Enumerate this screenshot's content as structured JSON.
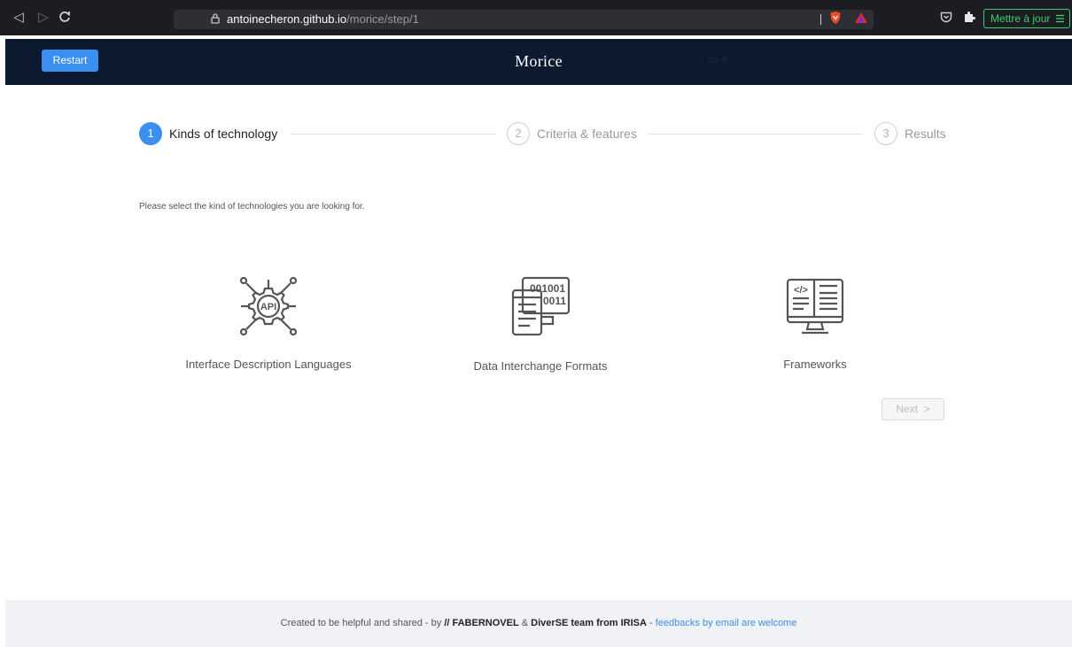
{
  "browser": {
    "url_domain": "antoinecheron.github.io",
    "url_path": "/morice/step/1",
    "update_label": "Mettre à jour"
  },
  "header": {
    "restart_label": "Restart",
    "title": "Morice",
    "col_label": "col-8"
  },
  "steps": [
    {
      "number": "1",
      "label": "Kinds of technology",
      "active": true
    },
    {
      "number": "2",
      "label": "Criteria & features",
      "active": false
    },
    {
      "number": "3",
      "label": "Results",
      "active": false
    }
  ],
  "intro": "Please select the kind of technologies you are looking for.",
  "options": [
    {
      "label": "Interface Description Languages",
      "icon": "api-gear-icon",
      "icon_text": "API"
    },
    {
      "label": "Data Interchange Formats",
      "icon": "binary-document-icon",
      "icon_text_top": "001001",
      "icon_text_mid": "0011"
    },
    {
      "label": "Frameworks",
      "icon": "code-monitor-icon",
      "icon_text": "</>"
    }
  ],
  "next_label": "Next",
  "footer": {
    "prefix": "Created to be helpful and shared - by",
    "brand1": "// FABERNOVEL",
    "amp": "&",
    "brand2": "DiverSE team from IRISA",
    "dash": "-",
    "link": "feedbacks by email are welcome"
  },
  "colors": {
    "accent": "#3b8ff0",
    "header_bg": "#0b1a2e",
    "footer_bg": "#f0f2f5",
    "update_green": "#3ccf6f"
  }
}
